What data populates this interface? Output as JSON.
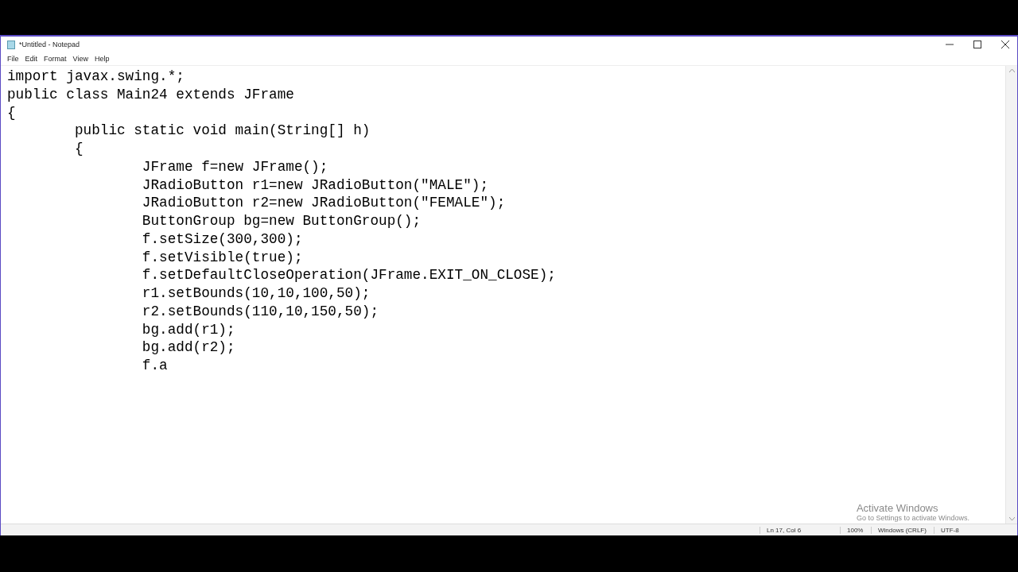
{
  "window": {
    "title": "*Untitled - Notepad"
  },
  "menu": [
    "File",
    "Edit",
    "Format",
    "View",
    "Help"
  ],
  "editor": {
    "lines": [
      "import javax.swing.*;",
      "public class Main24 extends JFrame",
      "{",
      "\tpublic static void main(String[] h)",
      "\t{",
      "\t\tJFrame f=new JFrame();",
      "\t\tJRadioButton r1=new JRadioButton(\"MALE\");",
      "\t\tJRadioButton r2=new JRadioButton(\"FEMALE\");",
      "\t\tButtonGroup bg=new ButtonGroup();",
      "\t\tf.setSize(300,300);",
      "\t\tf.setVisible(true);",
      "\t\tf.setDefaultCloseOperation(JFrame.EXIT_ON_CLOSE);",
      "\t\tr1.setBounds(10,10,100,50);",
      "\t\tr2.setBounds(110,10,150,50);",
      "\t\tbg.add(r1);",
      "\t\tbg.add(r2);",
      "\t\tf.a"
    ]
  },
  "activation_notice": {
    "title": "Activate Windows",
    "subtitle": "Go to Settings to activate Windows."
  },
  "status_bar": {
    "position": "Ln 17, Col 6",
    "zoom": "100%",
    "line_endings": "Windows (CRLF)",
    "encoding": "UTF-8"
  }
}
